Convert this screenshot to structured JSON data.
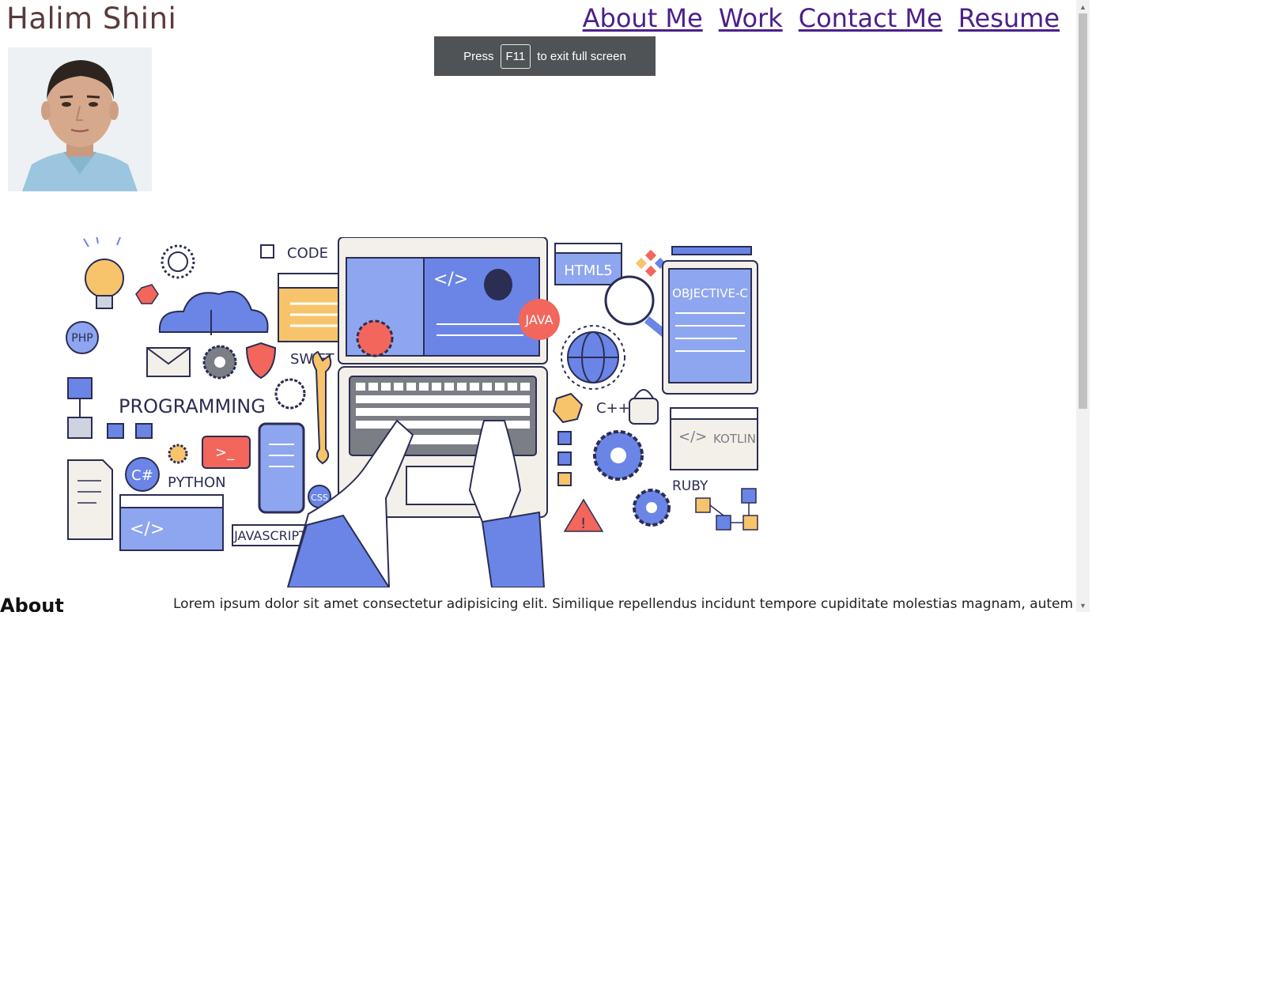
{
  "site": {
    "title": "Halim Shini"
  },
  "nav": {
    "links": [
      "About Me",
      "Work",
      "Contact Me",
      "Resume"
    ]
  },
  "fullscreen_toast": {
    "prefix": "Press",
    "key": "F11",
    "suffix": "to exit full screen"
  },
  "hero": {
    "labels": {
      "code": "CODE",
      "php": "PHP",
      "swift": "SWIFT",
      "programming": "PROGRAMMING",
      "python": "PYTHON",
      "csharp": "C#",
      "javascript": "JAVASCRIPT",
      "css": "CSS",
      "java": "JAVA",
      "html5": "HTML5",
      "objective_c": "OBJECTIVE-C",
      "cpp": "C++",
      "kotlin": "KOTLIN",
      "ruby": "RUBY"
    }
  },
  "about": {
    "heading": "About",
    "text": "Lorem ipsum dolor sit amet consectetur adipisicing elit. Similique repellendus incidunt tempore cupiditate molestias magnam, autem"
  },
  "icons": {
    "scroll_up": "scroll-up-arrow-icon",
    "scroll_down": "scroll-down-arrow-icon"
  }
}
